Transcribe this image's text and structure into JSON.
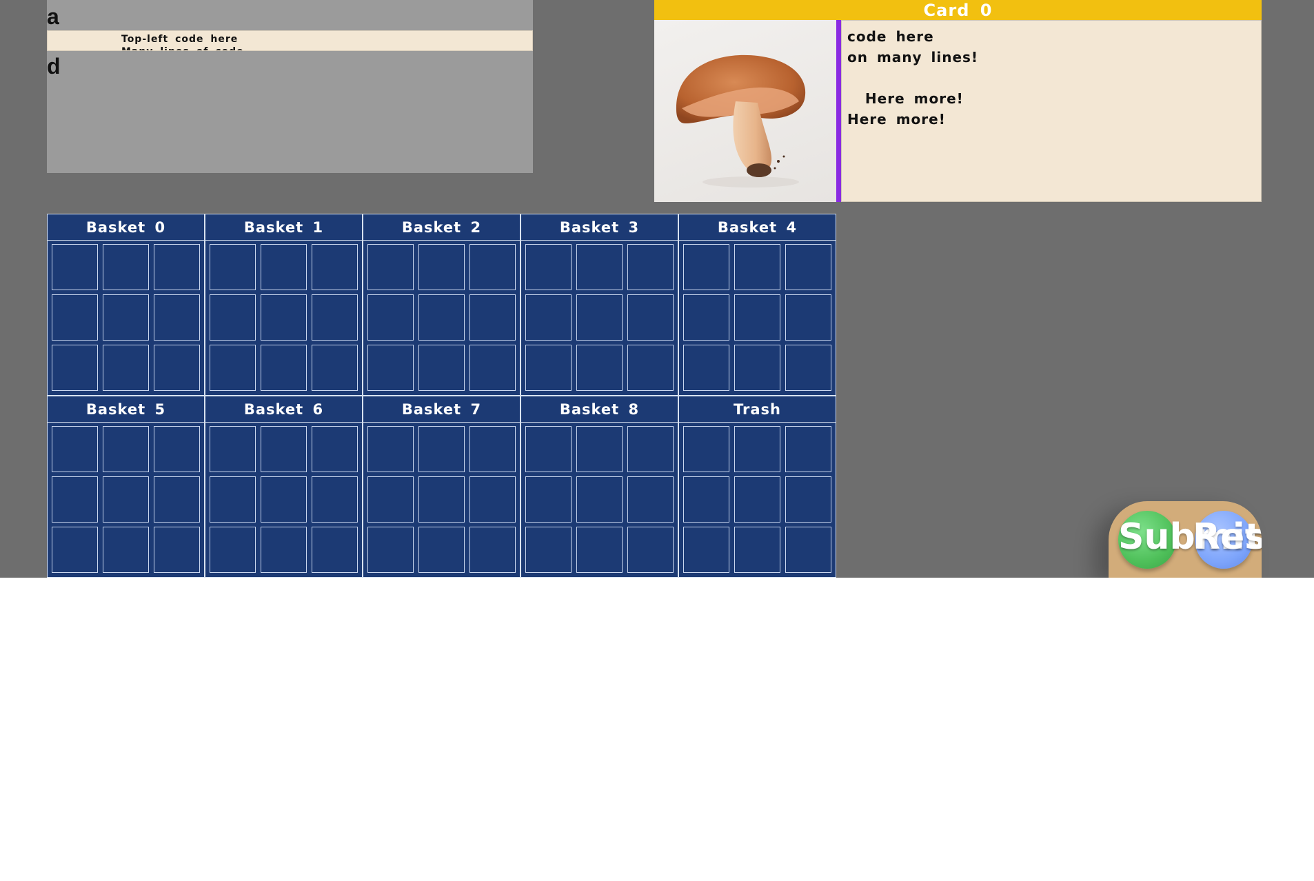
{
  "panel": {
    "label_top": "a",
    "label_bottom": "d",
    "code": "Top-left code here\nMany lines of code"
  },
  "card": {
    "title": "Card 0",
    "image_name": "mushroom-image",
    "text": "code here\non many lines!\n\n  Here more!\nHere more!"
  },
  "baskets": [
    {
      "title": "Basket 0"
    },
    {
      "title": "Basket 1"
    },
    {
      "title": "Basket 2"
    },
    {
      "title": "Basket 3"
    },
    {
      "title": "Basket 4"
    },
    {
      "title": "Basket 5"
    },
    {
      "title": "Basket 6"
    },
    {
      "title": "Basket 7"
    },
    {
      "title": "Basket 8"
    },
    {
      "title": "Trash"
    }
  ],
  "buttons": {
    "submit_label": "Submit",
    "reset_label": "Reset"
  },
  "colors": {
    "card_header": "#f2c010",
    "card_divider": "#8a2be2",
    "basket_fill": "#1c3a74",
    "submit": "#4fc05a",
    "reset": "#7ea5fb",
    "button_tray": "#d2ac7a"
  }
}
